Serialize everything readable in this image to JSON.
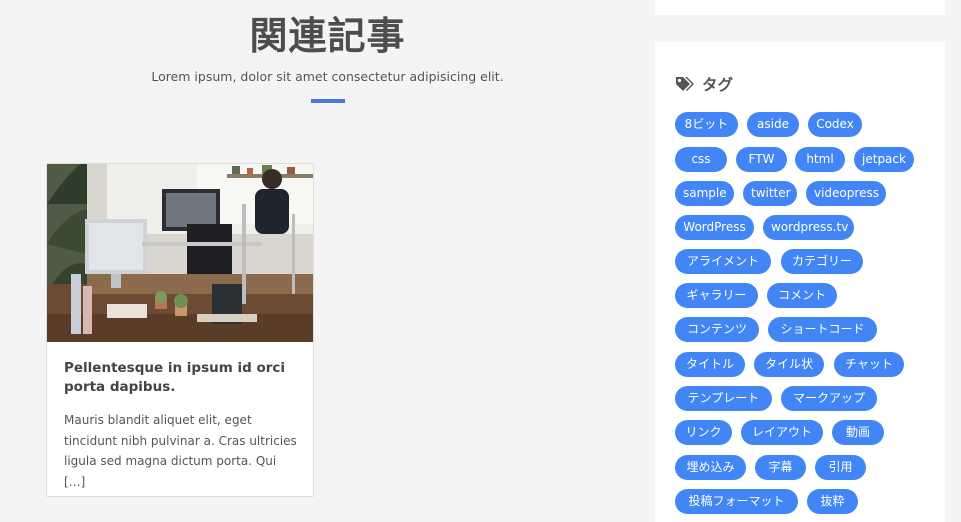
{
  "related": {
    "title": "関連記事",
    "subtitle": "Lorem ipsum, dolor sit amet consectetur adipisicing elit.",
    "accent_color": "#4a77e0",
    "card": {
      "image": "office-desk-photo",
      "title": "Pellentesque in ipsum id orci porta dapibus.",
      "excerpt": "Mauris blandit aliquet elit, eget tincidunt nibh pulvinar a. Cras ultricies ligula sed magna dictum porta. Qui […]"
    }
  },
  "sidebar": {
    "tags_widget": {
      "icon": "tags-icon",
      "title": "タグ",
      "tag_color": "#4285f4",
      "tags": [
        "8ビット",
        "aside",
        "Codex",
        "css",
        "FTW",
        "html",
        "jetpack",
        "sample",
        "twitter",
        "videopress",
        "WordPress",
        "wordpress.tv",
        "アライメント",
        "カテゴリー",
        "ギャラリー",
        "コメント",
        "コンテンツ",
        "ショートコード",
        "タイトル",
        "タイル状",
        "チャット",
        "テンプレート",
        "マークアップ",
        "リンク",
        "レイアウト",
        "動画",
        "埋め込み",
        "字幕",
        "引用",
        "投稿フォーマット",
        "抜粋"
      ]
    }
  }
}
